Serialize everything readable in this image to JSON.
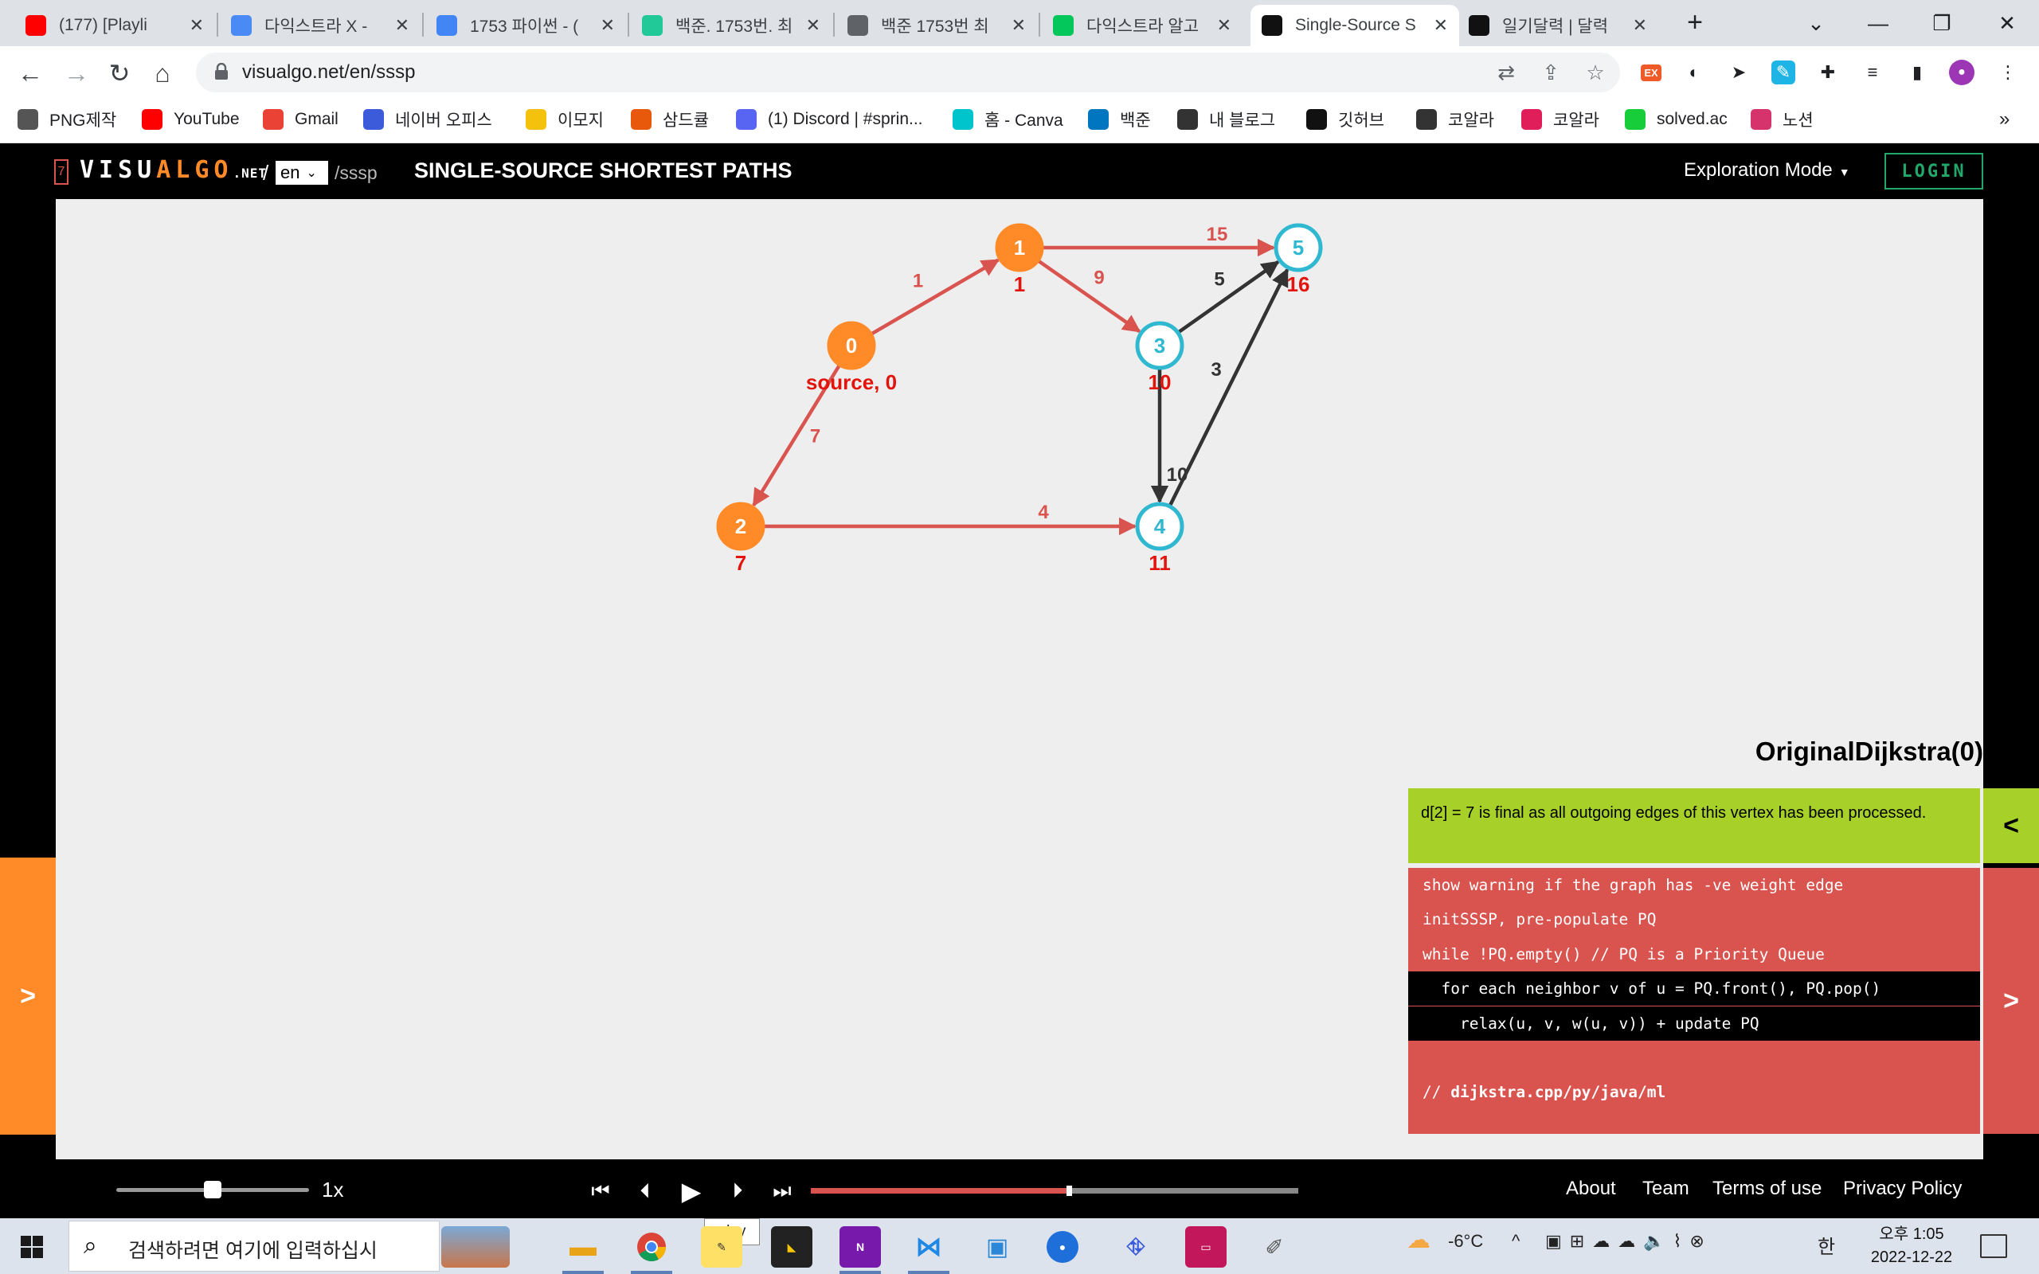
{
  "browser": {
    "tabs": [
      {
        "label": "(177) [Playli",
        "icon": "youtube-icon",
        "color": "#ff0000"
      },
      {
        "label": "다익스트라 X - ",
        "icon": "stack-icon",
        "color": "#4a8af4"
      },
      {
        "label": "1753 파이썬 - (",
        "icon": "google-icon",
        "color": "#4285f4"
      },
      {
        "label": "백준. 1753번. 최",
        "icon": "velog-icon",
        "color": "#20c997"
      },
      {
        "label": "백준 1753번 최",
        "icon": "globe-icon",
        "color": "#5f6368"
      },
      {
        "label": "다익스트라 알고",
        "icon": "blog-icon",
        "color": "#03c75a"
      },
      {
        "label": "Single-Source S",
        "icon": "visualgo-icon",
        "color": "#111111"
      },
      {
        "label": "일기달력 | 달력",
        "icon": "notion-icon",
        "color": "#111111"
      }
    ],
    "url": "visualgo.net/en/sssp",
    "bookmarks": [
      {
        "label": "PNG제작",
        "icon": "layers-icon",
        "color": "#555555"
      },
      {
        "label": "YouTube",
        "icon": "youtube-icon",
        "color": "#ff0000"
      },
      {
        "label": "Gmail",
        "icon": "gmail-icon",
        "color": "#ea4335"
      },
      {
        "label": "네이버 오피스",
        "icon": "office-icon",
        "color": "#3b5bdb"
      },
      {
        "label": "이모지",
        "icon": "emoji-icon",
        "color": "#f4c20d"
      },
      {
        "label": "삼드큘",
        "icon": "samdcul-icon",
        "color": "#e8590c"
      },
      {
        "label": "(1) Discord | #sprin...",
        "icon": "discord-icon",
        "color": "#5865f2"
      },
      {
        "label": "홈 - Canva",
        "icon": "canva-icon",
        "color": "#00c4cc"
      },
      {
        "label": "백준",
        "icon": "code-icon",
        "color": "#0076c0"
      },
      {
        "label": "내 블로그",
        "icon": "blog-dots-icon",
        "color": "#333333"
      },
      {
        "label": "깃허브",
        "icon": "github-icon",
        "color": "#111111"
      },
      {
        "label": "코알라",
        "icon": "koala-dots-icon",
        "color": "#333333"
      },
      {
        "label": "코알라",
        "icon": "slack-icon",
        "color": "#e01e5a"
      },
      {
        "label": "solved.ac",
        "icon": "solvedac-icon",
        "color": "#17ce3a"
      },
      {
        "label": "노션",
        "icon": "party-icon",
        "color": "#d6336c"
      }
    ],
    "more_bookmarks": "»"
  },
  "header": {
    "logo_prefix": "VISU",
    "logo_algo": "ALGO",
    "logo_net": ".NET",
    "beta_mark": "7",
    "slash": "/",
    "language": "en",
    "path": "/sssp",
    "title": "SINGLE-SOURCE SHORTEST PATHS",
    "mode": "Exploration Mode",
    "login": "LOGIN"
  },
  "colors": {
    "accent_orange": "#ff8a27",
    "edge_red": "#d9534f",
    "node_cyan": "#2fb8d0",
    "status_green": "#a7d129",
    "dist_red": "#e3140c"
  },
  "graph": {
    "nodes": [
      {
        "id": "0",
        "label": "0",
        "state": "done",
        "dist": "source, 0"
      },
      {
        "id": "1",
        "label": "1",
        "state": "done",
        "dist": "1"
      },
      {
        "id": "2",
        "label": "2",
        "state": "done",
        "dist": "7"
      },
      {
        "id": "3",
        "label": "3",
        "state": "pending",
        "dist": "10"
      },
      {
        "id": "4",
        "label": "4",
        "state": "pending",
        "dist": "11"
      },
      {
        "id": "5",
        "label": "5",
        "state": "pending",
        "dist": "16"
      }
    ],
    "edges": [
      {
        "from": "0",
        "to": "1",
        "weight": "1",
        "state": "tree"
      },
      {
        "from": "0",
        "to": "2",
        "weight": "7",
        "state": "tree"
      },
      {
        "from": "1",
        "to": "3",
        "weight": "9",
        "state": "tree"
      },
      {
        "from": "1",
        "to": "5",
        "weight": "15",
        "state": "tree"
      },
      {
        "from": "2",
        "to": "4",
        "weight": "4",
        "state": "tree"
      },
      {
        "from": "3",
        "to": "5",
        "weight": "5",
        "state": "normal"
      },
      {
        "from": "3",
        "to": "4",
        "weight": "10",
        "state": "normal"
      },
      {
        "from": "4",
        "to": "5",
        "weight": "3",
        "state": "normal"
      }
    ]
  },
  "panel": {
    "algorithm": "OriginalDijkstra(0)",
    "status": "d[2] = 7 is final as all outgoing edges of this vertex has been processed.",
    "code": [
      "show warning if the graph has -ve weight edge",
      "initSSSP, pre-populate PQ",
      "while !PQ.empty() // PQ is a Priority Queue",
      "  for each neighbor v of u = PQ.front(), PQ.pop()",
      "    relax(u, v, w(u, v)) + update PQ",
      ""
    ],
    "code_comment_prefix": "// ",
    "code_comment_link": "dijkstra.cpp/py/java/ml",
    "open_left": ">",
    "collapse_right": "<",
    "next_right": ">"
  },
  "player": {
    "speed": "1x",
    "progress": 0.53
  },
  "footer": {
    "links": [
      "About",
      "Team",
      "Terms of use",
      "Privacy Policy"
    ]
  },
  "taskbar": {
    "search_placeholder": "검색하려면 여기에 입력하십시",
    "tooltip": "play",
    "weather": "-6°C",
    "ime": "한",
    "time": "오후 1:05",
    "date": "2022-12-22"
  }
}
